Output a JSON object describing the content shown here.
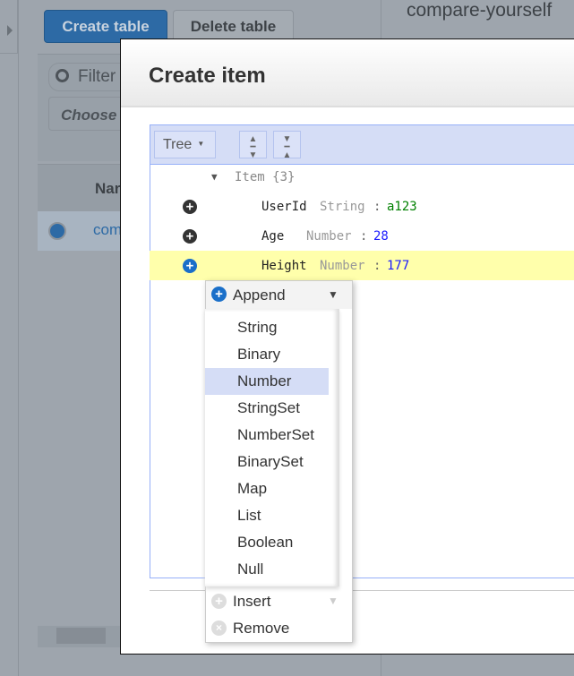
{
  "background": {
    "create_table": "Create table",
    "delete_table": "Delete table",
    "filter_placeholder": "Filter",
    "choose_placeholder": "Choose",
    "name_header": "Nar",
    "row_name": "com",
    "table_title": "compare-yourself"
  },
  "modal": {
    "title": "Create item",
    "mode": "Tree",
    "tree": {
      "root": "Item",
      "root_count": "{3}",
      "fields": [
        {
          "name": "UserId",
          "type": "String",
          "value": "a123",
          "color": "#008000"
        },
        {
          "name": "Age",
          "type": "Number",
          "value": "28",
          "color": "#1a1aff"
        },
        {
          "name": "Height",
          "type": "Number",
          "value": "177",
          "color": "#1a1aff"
        }
      ]
    },
    "menu": {
      "append": "Append",
      "insert": "Insert",
      "remove": "Remove",
      "types": [
        "String",
        "Binary",
        "Number",
        "StringSet",
        "NumberSet",
        "BinarySet",
        "Map",
        "List",
        "Boolean",
        "Null"
      ],
      "highlighted": "Number"
    }
  },
  "colors": {
    "primary": "#2d6aa5",
    "toolbar": "#d5ddf6",
    "highlight_row": "#ffffab"
  }
}
